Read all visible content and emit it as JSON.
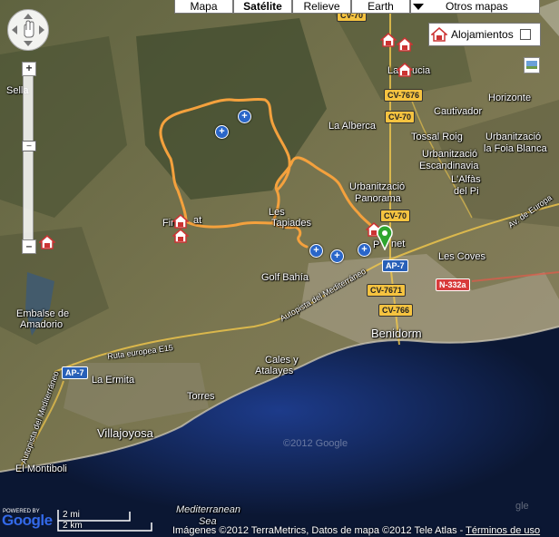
{
  "map_types": {
    "mapa": "Mapa",
    "satelite": "Satélite",
    "relieve": "Relieve",
    "earth": "Earth",
    "otros": "Otros mapas"
  },
  "alojamientos": {
    "label": "Alojamientos"
  },
  "places": {
    "sella": "Sella",
    "la_alberca": "La Alberca",
    "cautivador": "Cautivador",
    "horizonte": "Horizonte",
    "tossal_roig": "Tossal Roig",
    "urb_foia_1": "Urbanització",
    "urb_foia_2": "la Foia Blanca",
    "urb_esc_1": "Urbanització",
    "urb_esc_2": "Escandinavia",
    "lalfas_1": "L'Alfàs",
    "lalfas_2": "del Pi",
    "urb_pan_1": "Urbanització",
    "urb_pan_2": "Panorama",
    "finestrat": "Fin",
    "finestrat_b": "at",
    "les_1": "Les",
    "les_2": "Tapiades",
    "polop": "P",
    "polop_b": "net",
    "la_nucia": "La",
    "la_nucia_b": "ucia",
    "golf_bahia": "Golf Bahía",
    "les_coves": "Les Coves",
    "embalse_1": "Embalse de",
    "embalse_2": "Amadorio",
    "benidorm": "Benidorm",
    "cales_1": "Cales y",
    "cales_2": "Atalayes",
    "la_ermita": "La Ermita",
    "torres": "Torres",
    "villajoyosa": "Villajoyosa",
    "el_montiboli": "El Montiboli",
    "med_1": "Mediterranean",
    "med_2": "Sea",
    "ruta_e15": "Ruta europea E15",
    "autopista_1": "Autopista del Mediterráneo",
    "autopista_2": "Autopista del Mediterráneo",
    "av_europa": "Av. de Europa",
    "watermark": "©2012 Google",
    "gle": "gle"
  },
  "shields": {
    "cv7676": "CV-7676",
    "cv70a": "CV-70",
    "cv70b": "CV-70",
    "cv70c": "CV-70",
    "ap7a": "AP-7",
    "ap7b": "AP-7",
    "cv7671": "CV-7671",
    "cv766": "CV-766",
    "n332a": "N-332a"
  },
  "bottom": {
    "powered": "POWERED BY",
    "google": "Google",
    "scale_mi": "2 mi",
    "scale_km": "2 km",
    "copyright": "Imágenes ©2012 TerraMetrics, Datos de mapa ©2012 Tele Atlas - ",
    "terms": "Términos de uso"
  },
  "colors": {
    "route": "#f4a13d",
    "sea": "#0d1b3a",
    "land": "#6b6a45",
    "marker_blue": "#2a66c9",
    "marker_house": "#c33333",
    "marker_green": "#2ea52e"
  }
}
